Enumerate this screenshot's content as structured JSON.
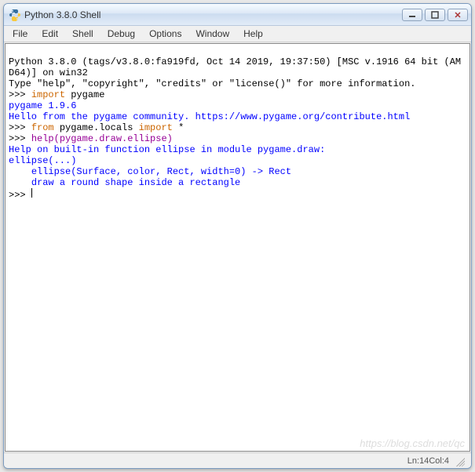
{
  "window": {
    "title": "Python 3.8.0 Shell"
  },
  "menu": {
    "file": "File",
    "edit": "Edit",
    "shell": "Shell",
    "debug": "Debug",
    "options": "Options",
    "window": "Window",
    "help": "Help"
  },
  "lines": {
    "l1": "Python 3.8.0 (tags/v3.8.0:fa919fd, Oct 14 2019, 19:37:50) [MSC v.1916 64 bit (AMD64)] on win32",
    "l2a": "Type \"help\", \"copyright\", \"credits\" or \"license()\" for more information.",
    "prompt": ">>> ",
    "imp": "import",
    "frm": "from",
    "pygame": " pygame",
    "l4": "pygame 1.9.6",
    "l5": "Hello from the pygame community. https://www.pygame.org/contribute.html",
    "l6b": " pygame.locals ",
    "l6c": " *",
    "l7": "help(pygame.draw.ellipse)",
    "l8": "Help on built-in function ellipse in module pygame.draw:",
    "l9": "",
    "l10": "ellipse(...)",
    "l11": "    ellipse(Surface, color, Rect, width=0) -> Rect",
    "l12": "    draw a round shape inside a rectangle",
    "l13": ""
  },
  "status": {
    "ln_label": "Ln: ",
    "ln": "14",
    "col_label": "  Col: ",
    "col": "4"
  },
  "watermark": "https://blog.csdn.net/qc"
}
